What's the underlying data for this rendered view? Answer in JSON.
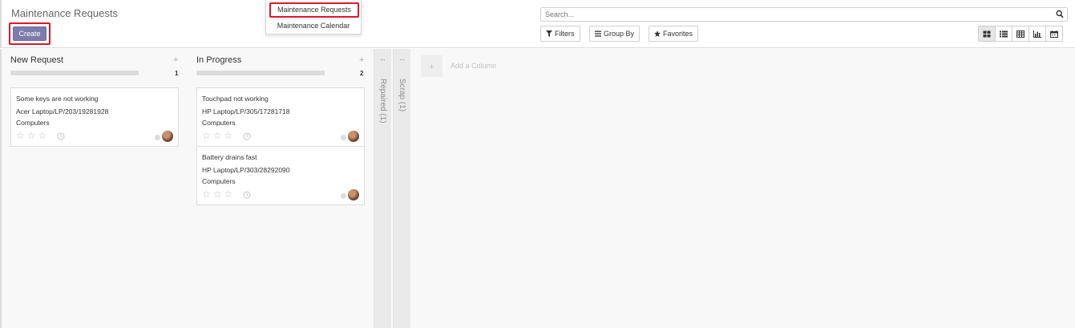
{
  "control_panel": {
    "title": "Maintenance Requests",
    "create_label": "Create",
    "search_placeholder": "Search...",
    "filters_label": "Filters",
    "group_by_label": "Group By",
    "favorites_label": "Favorites"
  },
  "breadcrumb_menu": {
    "items": [
      "Maintenance Requests",
      "Maintenance Calendar"
    ]
  },
  "view_switcher": [
    "kanban-icon",
    "list-icon",
    "pivot-icon",
    "graph-icon",
    "calendar-icon"
  ],
  "columns": [
    {
      "title": "New Request",
      "count": "1",
      "cards": [
        {
          "title": "Some keys are not working",
          "equipment": "Acer Laptop/LP/203/19281928",
          "category": "Computers"
        }
      ]
    },
    {
      "title": "In Progress",
      "count": "2",
      "cards": [
        {
          "title": "Touchpad not working",
          "equipment": "HP Laptop/LP/305/17281718",
          "category": "Computers"
        },
        {
          "title": "Battery drains fast",
          "equipment": "HP Laptop/LP/303/28292090",
          "category": "Computers"
        }
      ]
    }
  ],
  "folded_columns": [
    "Repaired (1)",
    "Scrap (1)"
  ],
  "add_column_label": "Add a Column",
  "colors": {
    "accent": "#7c7bad",
    "highlight": "#e0162b"
  }
}
